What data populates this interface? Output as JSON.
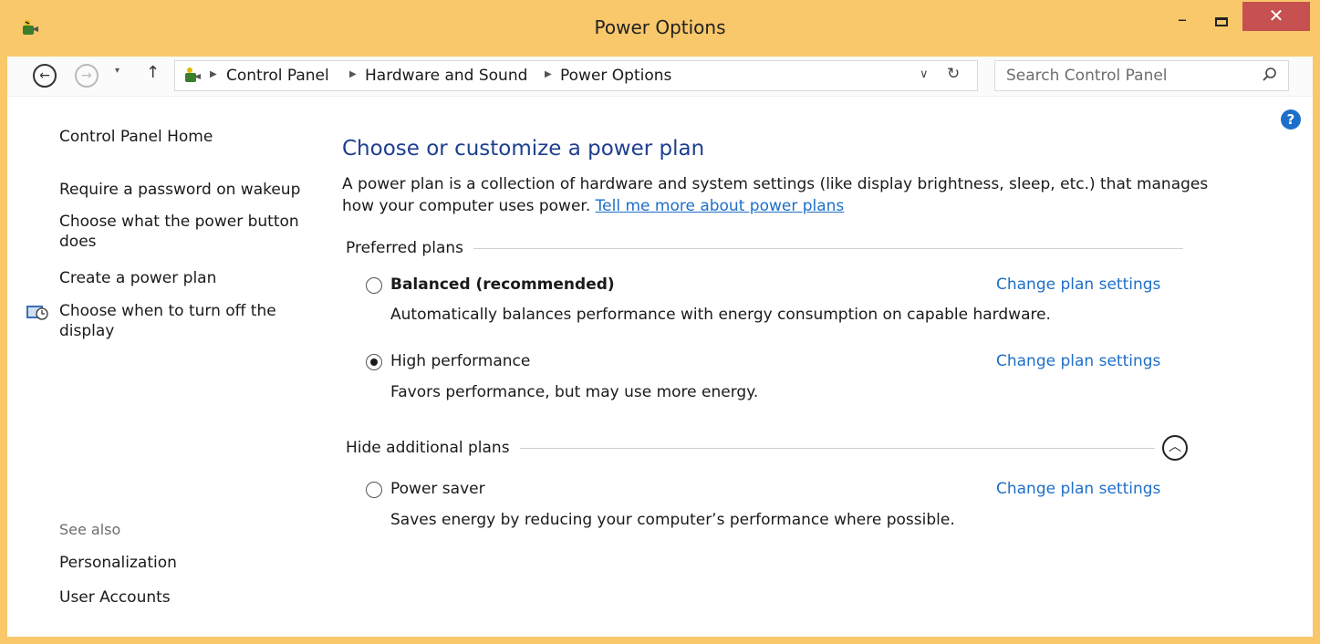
{
  "window": {
    "title": "Power Options",
    "minimize": "–",
    "close": "✕"
  },
  "navbar": {
    "back": "←",
    "forward": "→",
    "recent": "▾",
    "up": "↑",
    "breadcrumbs": [
      "Control Panel",
      "Hardware and Sound",
      "Power Options"
    ],
    "search_placeholder": "Search Control Panel"
  },
  "sidebar": {
    "home": "Control Panel Home",
    "links": [
      "Require a password on wakeup",
      "Choose what the power button does",
      "Create a power plan",
      "Choose when to turn off the display"
    ],
    "see_also": "See also",
    "see_also_links": [
      "Personalization",
      "User Accounts"
    ]
  },
  "main": {
    "heading": "Choose or customize a power plan",
    "intro": "A power plan is a collection of hardware and system settings (like display brightness, sleep, etc.) that manages how your computer uses power.",
    "intro_link": "Tell me more about power plans",
    "preferred_label": "Preferred plans",
    "additional_label": "Hide additional plans",
    "change_link": "Change plan settings",
    "plans": [
      {
        "name": "Balanced (recommended)",
        "desc": "Automatically balances performance with energy consumption on capable hardware.",
        "selected": false
      },
      {
        "name": "High performance",
        "desc": "Favors performance, but may use more energy.",
        "selected": true
      },
      {
        "name": "Power saver",
        "desc": "Saves energy by reducing your computer’s performance where possible.",
        "selected": false
      }
    ]
  },
  "colors": {
    "frame": "#f9c86b",
    "close_button": "#c75050",
    "link": "#1e6fc9",
    "heading": "#1e3f8f"
  }
}
